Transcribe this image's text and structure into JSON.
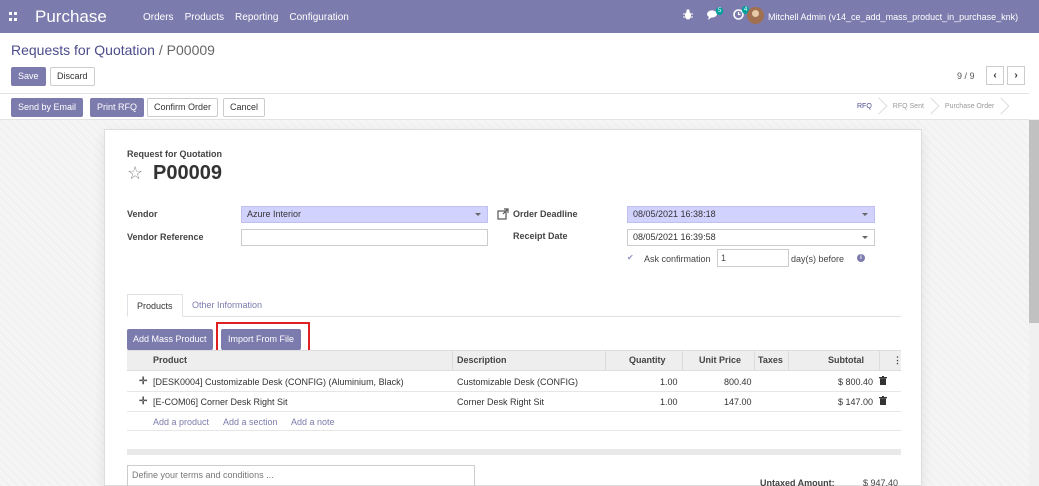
{
  "navbar": {
    "brand": "Purchase",
    "menu": [
      "Orders",
      "Products",
      "Reporting",
      "Configuration"
    ],
    "messages_badge": "5",
    "activities_badge": "4",
    "user": "Mitchell Admin (v14_ce_add_mass_product_in_purchase_knk)"
  },
  "breadcrumb": {
    "parent": "Requests for Quotation",
    "separator": "/",
    "current": "P00009"
  },
  "actions": {
    "save": "Save",
    "discard": "Discard"
  },
  "pager": {
    "text": "9 / 9",
    "prev": "‹",
    "next": "›"
  },
  "header_buttons": {
    "send_email": "Send by Email",
    "print_rfq": "Print RFQ",
    "confirm": "Confirm Order",
    "cancel": "Cancel"
  },
  "statusbar": [
    "RFQ",
    "RFQ Sent",
    "Purchase Order"
  ],
  "form": {
    "doc_type": "Request for Quotation",
    "name": "P00009",
    "vendor_label": "Vendor",
    "vendor_value": "Azure Interior",
    "vendor_ref_label": "Vendor Reference",
    "vendor_ref_value": "",
    "order_deadline_label": "Order Deadline",
    "order_deadline_value": "08/05/2021 16:38:18",
    "receipt_date_label": "Receipt Date",
    "receipt_date_value": "08/05/2021 16:39:58",
    "ask_confirmation_label": "Ask confirmation",
    "ask_confirmation_days": "1",
    "days_before_label": "day(s) before"
  },
  "tabs": [
    "Products",
    "Other Information"
  ],
  "line_buttons": {
    "add_mass": "Add Mass Product",
    "import": "Import From File"
  },
  "table": {
    "headers": [
      "Product",
      "Description",
      "Quantity",
      "Unit Price",
      "Taxes",
      "Subtotal"
    ],
    "rows": [
      {
        "product": "[DESK0004] Customizable Desk (CONFIG) (Aluminium, Black)",
        "description": "Customizable Desk (CONFIG)",
        "quantity": "1.00",
        "unit_price": "800.40",
        "taxes": "",
        "subtotal": "$ 800.40"
      },
      {
        "product": "[E-COM06] Corner Desk Right Sit",
        "description": "Corner Desk Right Sit",
        "quantity": "1.00",
        "unit_price": "147.00",
        "taxes": "",
        "subtotal": "$ 147.00"
      }
    ],
    "add_links": [
      "Add a product",
      "Add a section",
      "Add a note"
    ]
  },
  "terms_placeholder": "Define your terms and conditions ...",
  "totals": {
    "untaxed_label": "Untaxed Amount:",
    "untaxed_value": "$ 947.40"
  },
  "colors": {
    "primary": "#7c7bad",
    "required_field": "#d2d2ff",
    "highlight": "#e02020"
  }
}
